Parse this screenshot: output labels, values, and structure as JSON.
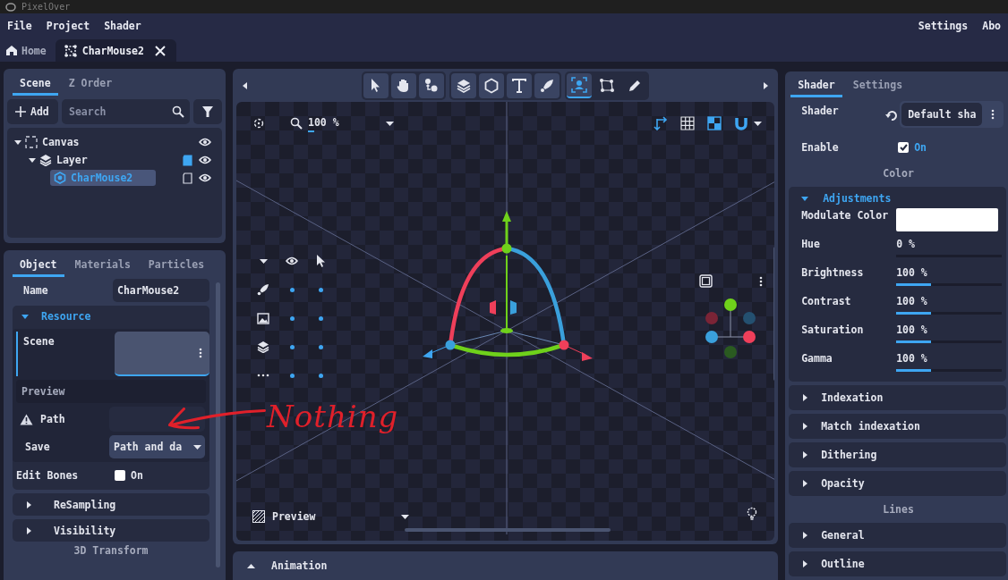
{
  "window": {
    "title": "PixelOver"
  },
  "menu": {
    "left": [
      "File",
      "Project",
      "Shader"
    ],
    "right": [
      "Settings",
      "Abo"
    ]
  },
  "doc_tabs": [
    {
      "label": "Home",
      "kind": "home",
      "selected": false
    },
    {
      "label": "CharMouse2",
      "kind": "scene",
      "selected": true
    }
  ],
  "scene_panel": {
    "tabs": [
      {
        "label": "Scene",
        "selected": true
      },
      {
        "label": "Z Order",
        "selected": false
      }
    ],
    "add_button": "Add",
    "search": {
      "placeholder": "Search"
    },
    "tree": [
      {
        "label": "Canvas",
        "kind": "canvas",
        "selected": false,
        "expanded": true,
        "children": [
          {
            "label": "Layer",
            "kind": "layer",
            "selected": false,
            "expanded": true,
            "children": [
              {
                "label": "CharMouse2",
                "kind": "node",
                "selected": true
              }
            ]
          }
        ]
      }
    ]
  },
  "object_panel": {
    "tabs": [
      {
        "label": "Object",
        "selected": true
      },
      {
        "label": "Materials",
        "selected": false
      },
      {
        "label": "Particles",
        "selected": false
      }
    ],
    "name": {
      "label": "Name",
      "value": "CharMouse2"
    },
    "resource": {
      "title": "Resource",
      "expanded": true,
      "scene_label": "Scene",
      "preview_label": "Preview",
      "path_label": "Path",
      "save": {
        "label": "Save",
        "value": "Path and da"
      }
    },
    "edit_bones": {
      "label": "Edit Bones",
      "checked": false,
      "text": "On"
    },
    "sections": [
      {
        "title": "ReSampling",
        "expanded": false
      },
      {
        "title": "Visibility",
        "expanded": false
      }
    ],
    "footer": "3D Transform"
  },
  "viewport": {
    "tool_groups": [
      [
        {
          "kind": "pointer",
          "selected": false
        },
        {
          "kind": "hand",
          "selected": false
        },
        {
          "kind": "bones",
          "selected": false
        }
      ],
      [
        {
          "kind": "layers",
          "selected": false
        },
        {
          "kind": "hexagon",
          "selected": false
        },
        {
          "kind": "text",
          "selected": false
        },
        {
          "kind": "rocket",
          "selected": false
        }
      ],
      [
        {
          "kind": "portrait",
          "selected": true
        },
        {
          "kind": "polygon",
          "selected": false
        },
        {
          "kind": "pencil",
          "selected": false
        }
      ]
    ],
    "zoom": "100 %",
    "preview": "Preview"
  },
  "animation": {
    "title": "Animation"
  },
  "shader_panel": {
    "tabs": [
      {
        "label": "Shader",
        "selected": true
      },
      {
        "label": "Settings",
        "selected": false
      }
    ],
    "shader": {
      "label": "Shader",
      "value": "Default sha"
    },
    "enable": {
      "label": "Enable",
      "checked": true,
      "text": "On"
    },
    "color_heading": "Color",
    "adjustments": {
      "title": "Adjustments",
      "expanded": true,
      "rows": [
        {
          "kind": "color",
          "label": "Modulate Color"
        },
        {
          "kind": "slider",
          "label": "Hue",
          "value": "0 %",
          "level": 0
        },
        {
          "kind": "slider",
          "label": "Brightness",
          "value": "100 %",
          "level": 0.33
        },
        {
          "kind": "slider",
          "label": "Contrast",
          "value": "100 %",
          "level": 0.33
        },
        {
          "kind": "slider",
          "label": "Saturation",
          "value": "100 %",
          "level": 0.33
        },
        {
          "kind": "slider",
          "label": "Gamma",
          "value": "100 %",
          "level": 0.33
        }
      ]
    },
    "color_sections": [
      {
        "title": "Indexation",
        "expanded": false
      },
      {
        "title": "Match indexation",
        "expanded": false
      },
      {
        "title": "Dithering",
        "expanded": false
      },
      {
        "title": "Opacity",
        "expanded": false
      }
    ],
    "lines_heading": "Lines",
    "lines_sections": [
      {
        "title": "General",
        "expanded": false
      },
      {
        "title": "Outline",
        "expanded": false
      }
    ]
  },
  "annotation": {
    "text": "Nothing"
  }
}
